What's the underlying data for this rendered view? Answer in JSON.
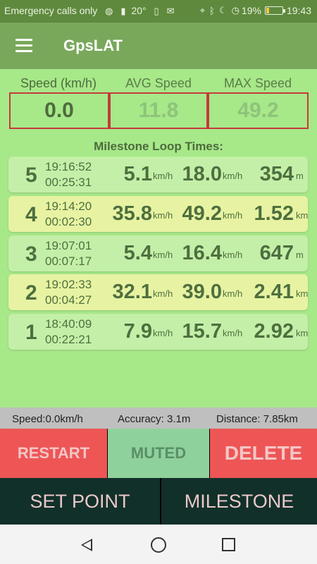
{
  "status": {
    "carrier": "Emergency calls only",
    "temperature": "20°",
    "battery_pct": "19%",
    "battery_level": 0.19,
    "time": "19:43",
    "icons": [
      "vpn-icon",
      "signal-icon",
      "sim-icon",
      "mail-icon",
      "location-icon",
      "bluetooth-icon",
      "moon-icon",
      "alarm-icon",
      "battery-icon"
    ]
  },
  "appbar": {
    "title": "GpsLAT",
    "menu_icon": "hamburger-menu-icon"
  },
  "stats": {
    "speed_label": "Speed (km/h)",
    "speed_value": "0.0",
    "avg_label": "AVG Speed",
    "avg_value": "11.8",
    "max_label": "MAX Speed",
    "max_value": "49.2"
  },
  "milestones_title": "Milestone Loop Times:",
  "milestones": [
    {
      "index": "5",
      "clock": "19:16:52",
      "duration": "00:25:31",
      "avg": "5.1",
      "avg_unit": "km/h",
      "max": "18.0",
      "max_unit": "km/h",
      "dist": "354",
      "dist_unit": "m",
      "color": "#c4efa8"
    },
    {
      "index": "4",
      "clock": "19:14:20",
      "duration": "00:02:30",
      "avg": "35.8",
      "avg_unit": "km/h",
      "max": "49.2",
      "max_unit": "km/h",
      "dist": "1.52",
      "dist_unit": "km",
      "color": "#e7f3a2"
    },
    {
      "index": "3",
      "clock": "19:07:01",
      "duration": "00:07:17",
      "avg": "5.4",
      "avg_unit": "km/h",
      "max": "16.4",
      "max_unit": "km/h",
      "dist": "647",
      "dist_unit": "m",
      "color": "#c4efa8"
    },
    {
      "index": "2",
      "clock": "19:02:33",
      "duration": "00:04:27",
      "avg": "32.1",
      "avg_unit": "km/h",
      "max": "39.0",
      "max_unit": "km/h",
      "dist": "2.41",
      "dist_unit": "km",
      "color": "#e7f3a2"
    },
    {
      "index": "1",
      "clock": "18:40:09",
      "duration": "00:22:21",
      "avg": "7.9",
      "avg_unit": "km/h",
      "max": "15.7",
      "max_unit": "km/h",
      "dist": "2.92",
      "dist_unit": "km",
      "color": "#c4efa8"
    }
  ],
  "footer": {
    "speed": "Speed:0.0km/h",
    "accuracy": "Accuracy: 3.1m",
    "distance": "Distance:  7.85km"
  },
  "buttons": {
    "restart": "RESTART",
    "muted": "MUTED",
    "delete": "DELETE",
    "set_point": "SET POINT",
    "milestone": "MILESTONE"
  },
  "colors": {
    "content_bg": "#a7e889",
    "appbar": "#79a85b",
    "red_button": "#ee5656",
    "muted_button": "#8fd19c",
    "dark_button": "#12302a"
  }
}
